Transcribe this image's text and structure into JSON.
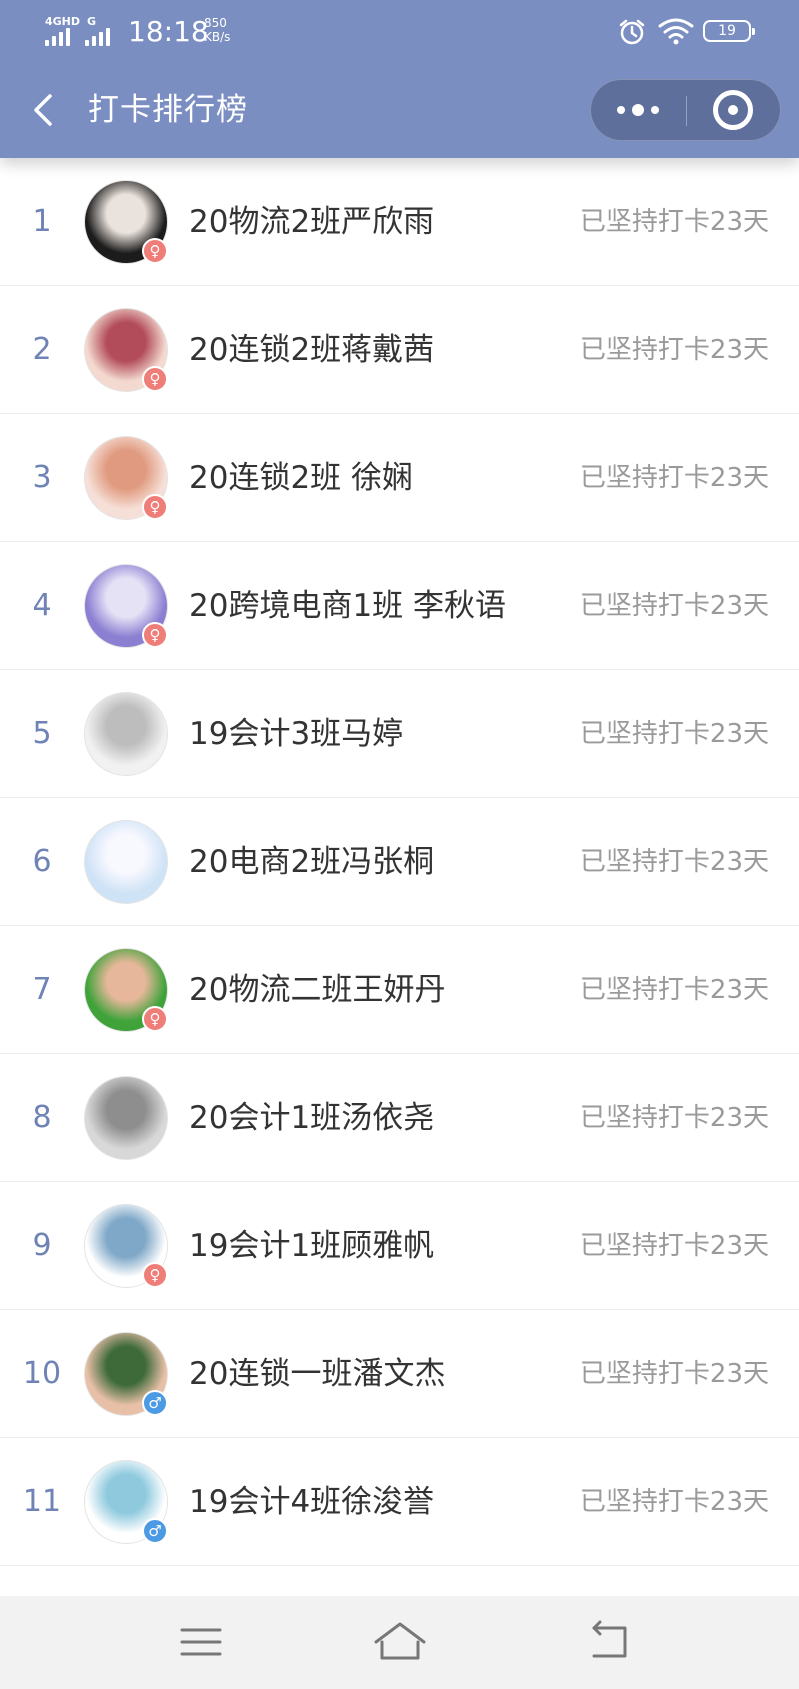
{
  "status_bar": {
    "network_1": "4GHD",
    "network_2": "G",
    "time": "18:18",
    "speed_value": "850",
    "speed_unit": "KB/s",
    "battery": "19"
  },
  "header": {
    "title": "打卡排行榜",
    "back_icon": "chevron-left-icon",
    "more_icon": "more-dots-icon",
    "close_icon": "target-circle-icon"
  },
  "leaderboard": [
    {
      "rank": "1",
      "name": "20物流2班严欣雨",
      "status": "已坚持打卡23天",
      "gender": "female"
    },
    {
      "rank": "2",
      "name": "20连锁2班蒋戴茜",
      "status": "已坚持打卡23天",
      "gender": "female"
    },
    {
      "rank": "3",
      "name": "20连锁2班 徐娴",
      "status": "已坚持打卡23天",
      "gender": "female"
    },
    {
      "rank": "4",
      "name": "20跨境电商1班 李秋语",
      "status": "已坚持打卡23天",
      "gender": "female"
    },
    {
      "rank": "5",
      "name": "19会计3班马婷",
      "status": "已坚持打卡23天",
      "gender": "none"
    },
    {
      "rank": "6",
      "name": "20电商2班冯张桐",
      "status": "已坚持打卡23天",
      "gender": "none"
    },
    {
      "rank": "7",
      "name": "20物流二班王妍丹",
      "status": "已坚持打卡23天",
      "gender": "female"
    },
    {
      "rank": "8",
      "name": "20会计1班汤依尧",
      "status": "已坚持打卡23天",
      "gender": "none"
    },
    {
      "rank": "9",
      "name": "19会计1班顾雅帆",
      "status": "已坚持打卡23天",
      "gender": "female"
    },
    {
      "rank": "10",
      "name": "20连锁一班潘文杰",
      "status": "已坚持打卡23天",
      "gender": "male"
    },
    {
      "rank": "11",
      "name": "19会计4班徐浚誉",
      "status": "已坚持打卡23天",
      "gender": "male"
    }
  ],
  "colors": {
    "header_bg": "#7b8ec2",
    "rank_text": "#6f83b6",
    "female_badge": "#ef7d78",
    "male_badge": "#4b9ae3"
  },
  "nav": {
    "menu_icon": "menu-icon",
    "home_icon": "home-icon",
    "back_icon": "return-icon"
  }
}
